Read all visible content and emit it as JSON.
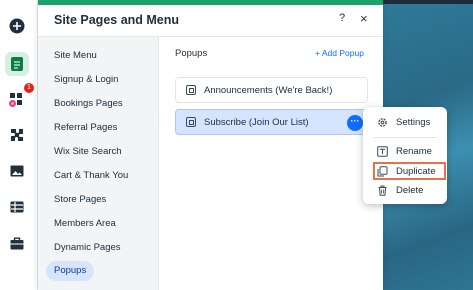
{
  "panel": {
    "title": "Site Pages and Menu",
    "help_label": "?",
    "close_label": "×"
  },
  "pages": [
    {
      "label": "Site Menu"
    },
    {
      "label": "Signup & Login"
    },
    {
      "label": "Bookings Pages"
    },
    {
      "label": "Referral Pages"
    },
    {
      "label": "Wix Site Search"
    },
    {
      "label": "Cart & Thank You"
    },
    {
      "label": "Store Pages"
    },
    {
      "label": "Members Area"
    },
    {
      "label": "Dynamic Pages"
    },
    {
      "label": "Popups"
    }
  ],
  "popups": {
    "title": "Popups",
    "add_label": "+ Add Popup",
    "items": [
      {
        "label": "Announcements (We're Back!)"
      },
      {
        "label": "Subscribe (Join Our List)"
      }
    ],
    "more_label": "···"
  },
  "context_menu": {
    "items": [
      {
        "label": "Settings",
        "icon": "gear-icon"
      },
      {
        "label": "Rename",
        "icon": "rename-icon"
      },
      {
        "label": "Duplicate",
        "icon": "duplicate-icon"
      },
      {
        "label": "Delete",
        "icon": "trash-icon"
      }
    ]
  },
  "rail": {
    "badge_count": "1",
    "icons": [
      "add-icon",
      "pages-icon",
      "apps-icon",
      "puzzle-icon",
      "media-icon",
      "table-icon",
      "briefcase-icon"
    ]
  },
  "colors": {
    "accent_green": "#1aa36a",
    "selected_blue": "#d5e5ff",
    "link_blue": "#116dff",
    "highlight_orange": "#e8714a",
    "badge_red": "#e62214"
  }
}
